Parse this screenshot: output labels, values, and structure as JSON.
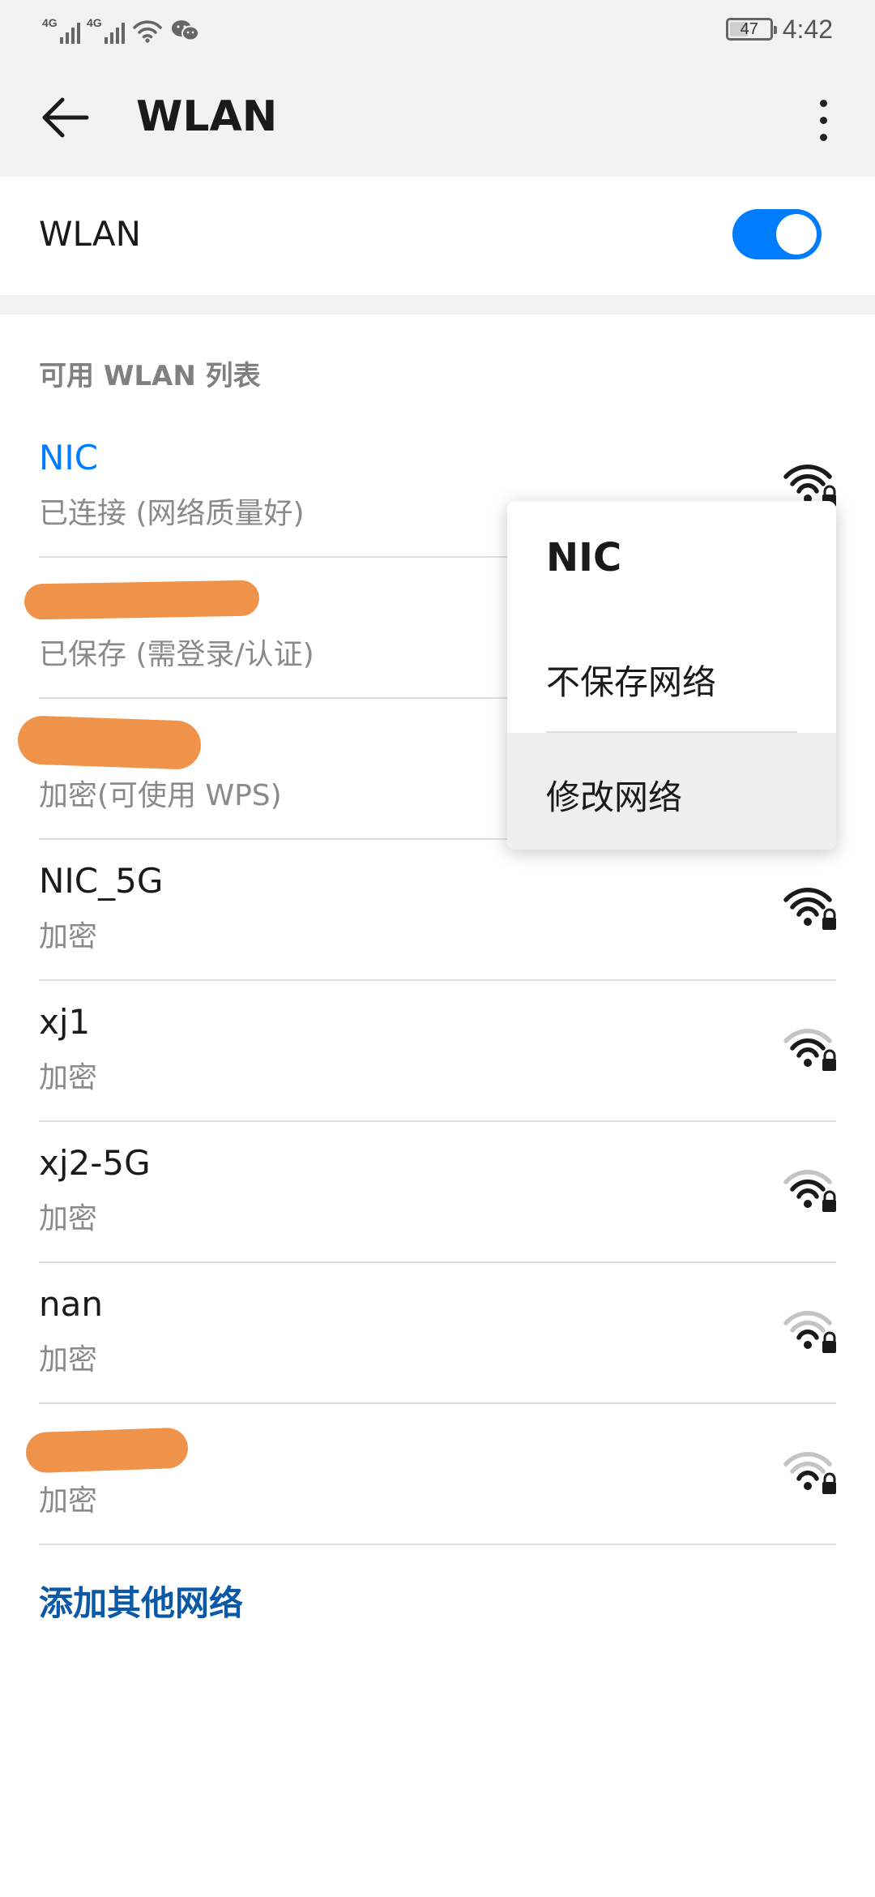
{
  "status_bar": {
    "signal_1": "4G",
    "signal_2": "4G",
    "battery": "47",
    "battery_level_percent": 47,
    "time": "4:42",
    "icons": [
      "signal-icon",
      "signal-icon",
      "wifi-icon",
      "wechat-icon",
      "battery-icon"
    ]
  },
  "app_bar": {
    "title": "WLAN",
    "back_icon": "arrow-left-icon",
    "more_icon": "more-vertical-icon"
  },
  "wlan_toggle": {
    "label": "WLAN",
    "enabled": true
  },
  "list": {
    "header": "可用 WLAN 列表",
    "networks": [
      {
        "name": "NIC",
        "status": "已连接 (网络质量好)",
        "connected": true,
        "signal_level": 4,
        "secured": true,
        "redacted": false
      },
      {
        "name": "",
        "status": "已保存 (需登录/认证)",
        "connected": false,
        "signal_level": 4,
        "secured": true,
        "redacted": true
      },
      {
        "name": "",
        "status": "加密(可使用 WPS)",
        "connected": false,
        "signal_level": 4,
        "secured": true,
        "redacted": true
      },
      {
        "name": "NIC_5G",
        "status": "加密",
        "connected": false,
        "signal_level": 4,
        "secured": true,
        "redacted": false
      },
      {
        "name": "xj1",
        "status": "加密",
        "connected": false,
        "signal_level": 3,
        "secured": true,
        "redacted": false
      },
      {
        "name": "xj2-5G",
        "status": "加密",
        "connected": false,
        "signal_level": 3,
        "secured": true,
        "redacted": false
      },
      {
        "name": "nan",
        "status": "加密",
        "connected": false,
        "signal_level": 2,
        "secured": true,
        "redacted": false
      },
      {
        "name": "",
        "status": "加密",
        "connected": false,
        "signal_level": 2,
        "secured": true,
        "redacted": true
      }
    ],
    "add_network": "添加其他网络"
  },
  "popup_menu": {
    "title": "NIC",
    "items": [
      "不保存网络",
      "修改网络"
    ]
  },
  "colors": {
    "accent": "#007dff",
    "link": "#0a59a8",
    "redaction": "#f0934a",
    "secondary_text": "#8a8a8a",
    "bar_background": "#f2f2f2"
  }
}
